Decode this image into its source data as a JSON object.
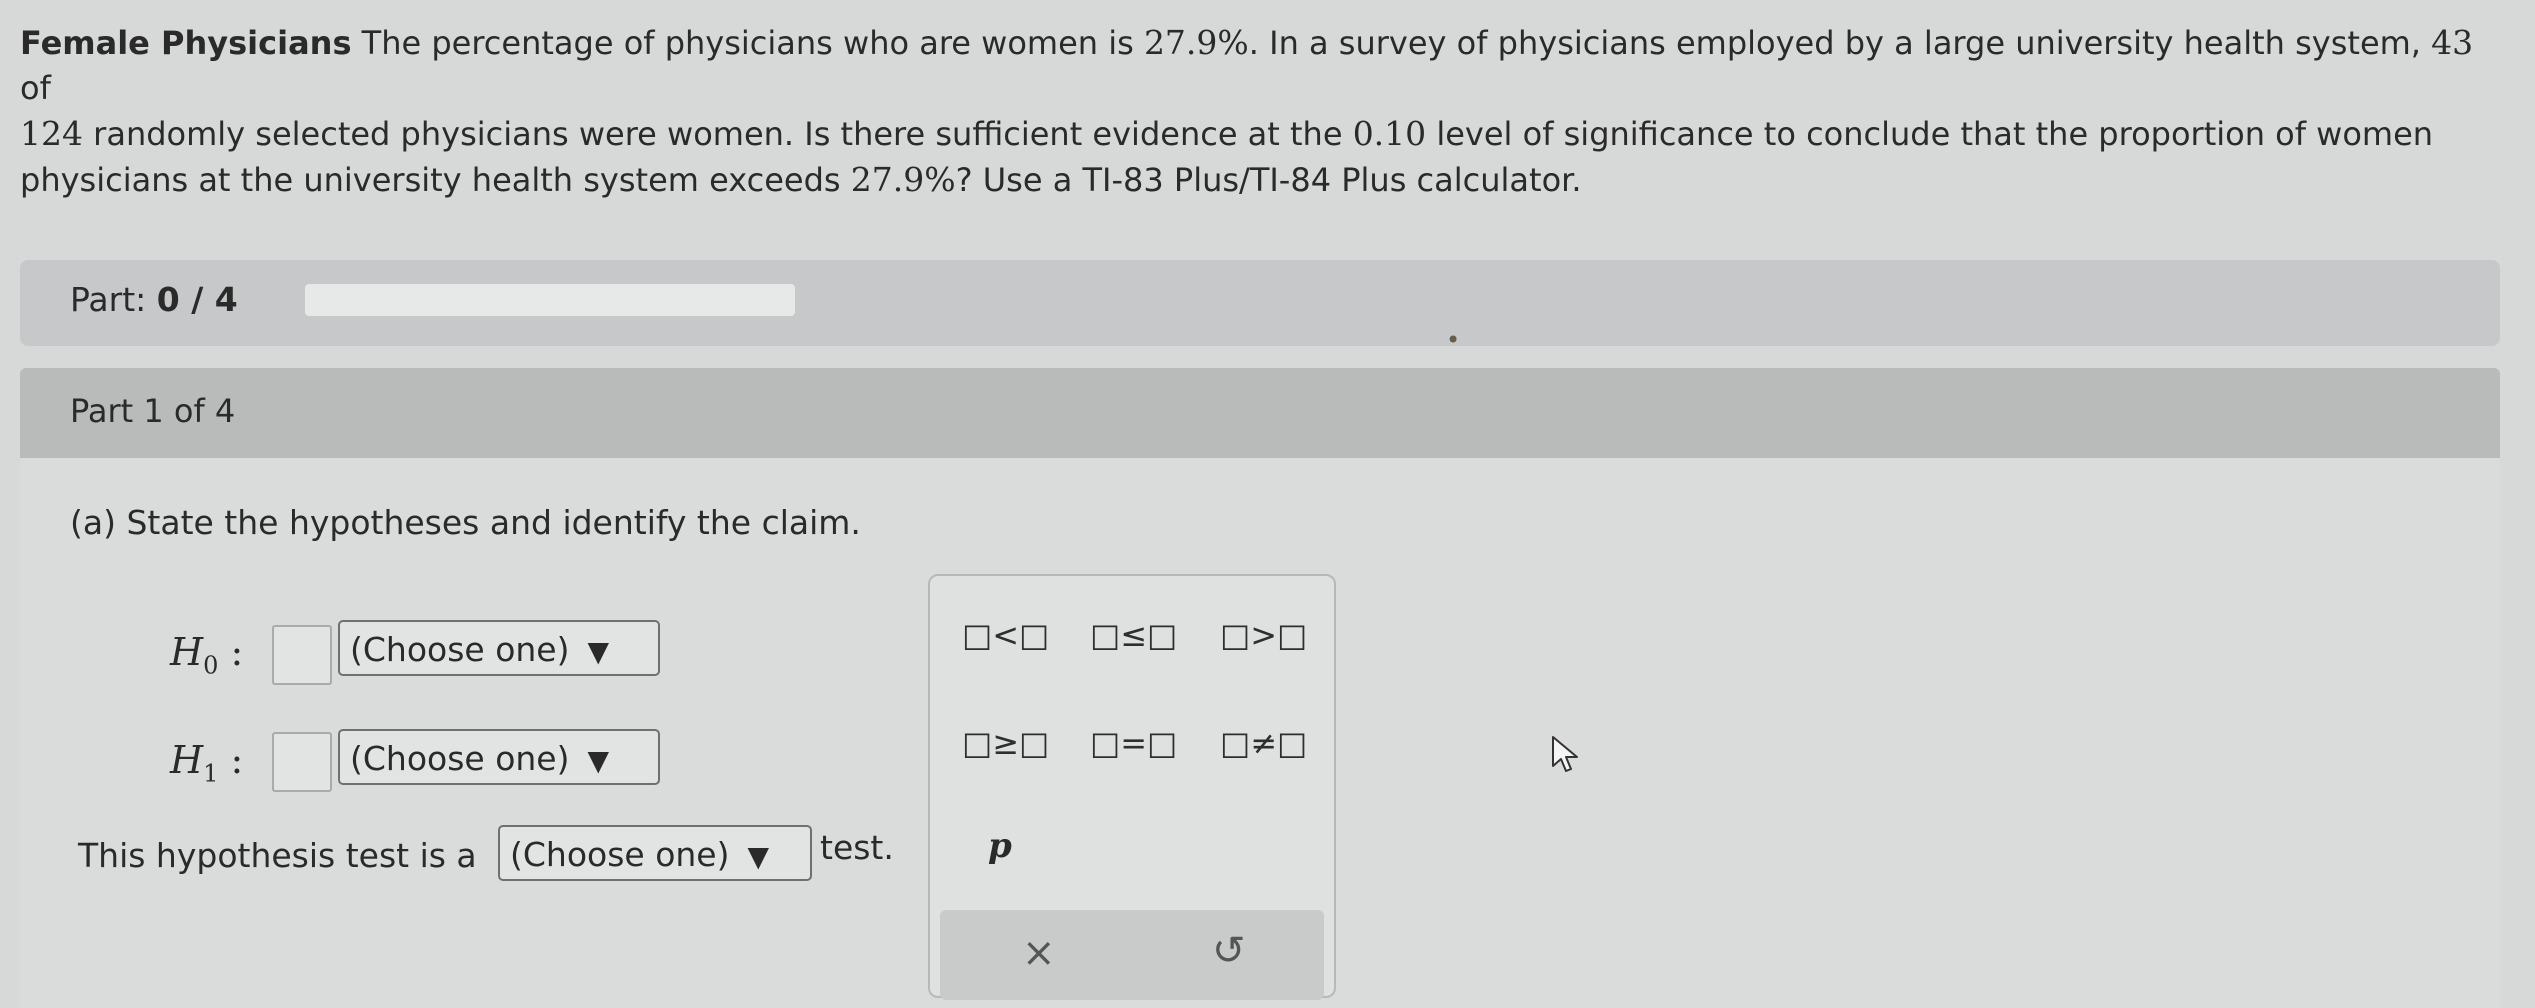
{
  "problem": {
    "title": "Female Physicians",
    "text1": " The percentage of physicians who are women is ",
    "pct1": "27.9%",
    "text2": ". In a survey of physicians employed by a large university health system, ",
    "n1": "43",
    "text3": " of",
    "n2": "124",
    "text4": " randomly selected physicians were women. Is there sufficient evidence at the ",
    "alpha": "0.10",
    "text5": " level of significance to conclude that the proportion of women",
    "text6": "physicians at the university health system exceeds ",
    "pct2": "27.9%",
    "text7": "? Use a TI-83 Plus/TI-84 Plus calculator."
  },
  "progress": {
    "label": "Part: ",
    "value": "0 / 4",
    "fraction": 0.0
  },
  "section": {
    "title": "Part 1 of 4",
    "question": "(a) State the hypotheses and identify the claim."
  },
  "h0": {
    "label": "H",
    "sub": "0",
    "colon": ":",
    "select": "(Choose one)"
  },
  "h1": {
    "label": "H",
    "sub": "1",
    "colon": ":",
    "select": "(Choose one)"
  },
  "test_line": {
    "prefix": "This hypothesis test is a",
    "select": "(Choose one)",
    "suffix": "test."
  },
  "palette": {
    "symbols": [
      "□<□",
      "□≤□",
      "□>□",
      "□≥□",
      "□=□",
      "□≠□"
    ],
    "p": "p",
    "clear": "×",
    "undo": "↺"
  },
  "icons": {
    "dropdown_arrow": "▼",
    "cursor": "cursor-arrow-icon"
  }
}
